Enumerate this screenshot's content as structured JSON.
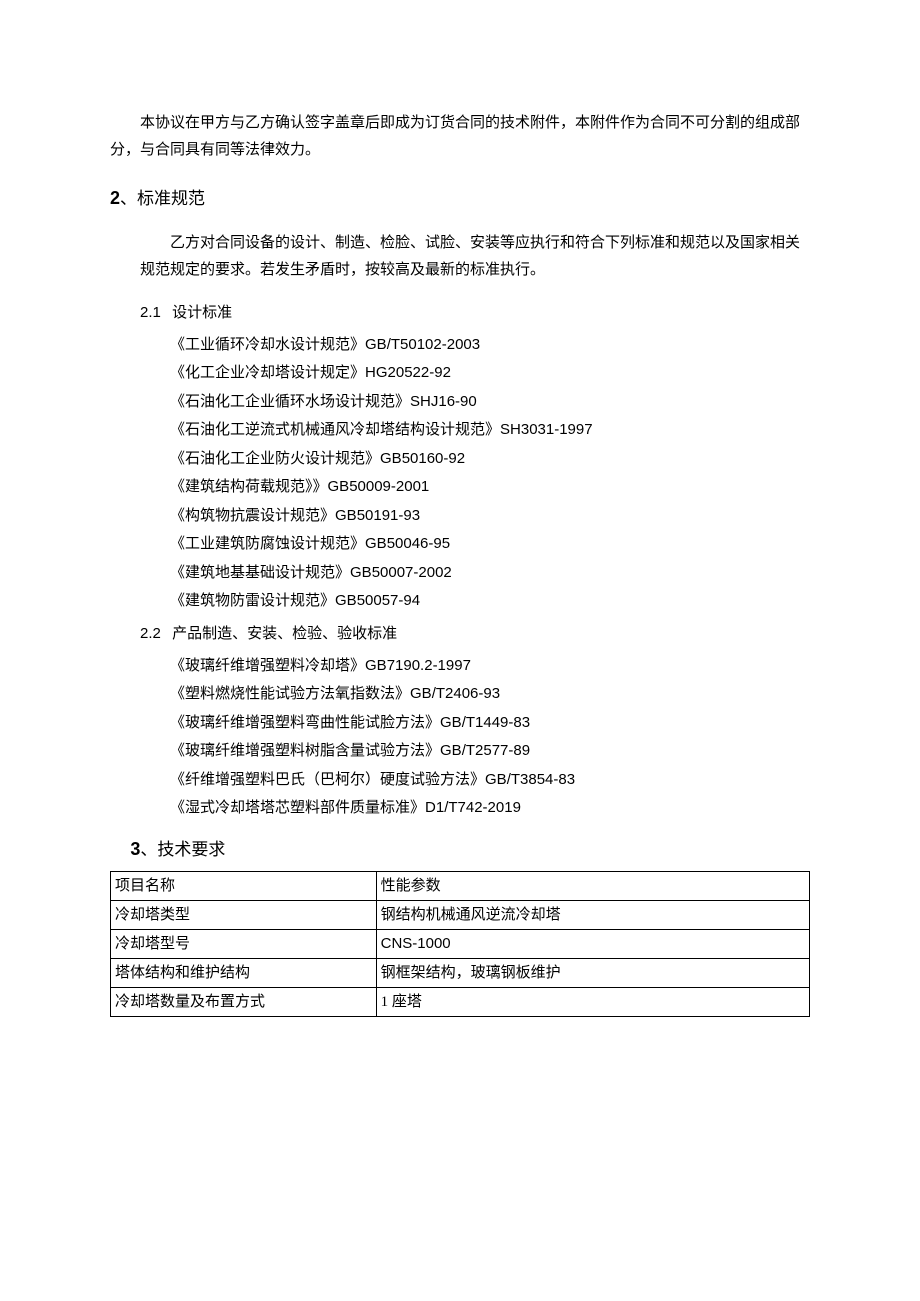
{
  "intro": "本协议在甲方与乙方确认签字盖章后即成为订货合同的技术附件，本附件作为合同不可分割的组成部分，与合同具有同等法律效力。",
  "section2": {
    "num": "2",
    "punct": "、",
    "title": "标准规范",
    "lead": "乙方对合同设备的设计、制造、检脸、试脸、安装等应执行和符合下列标准和规范以及国家相关规范规定的要求。若发生矛盾时，按较高及最新的标准执行。",
    "sub1": {
      "num": "2.1",
      "title": "设计标准"
    },
    "design_standards": [
      {
        "name": "《工业循环冷却水设计规范》",
        "code": "GB/T50102-2003"
      },
      {
        "name": "《化工企业冷却塔设计规定》",
        "code": "HG20522-92"
      },
      {
        "name": "《石油化工企业循环水场设计规范》",
        "code": "SHJ16-90"
      },
      {
        "name": "《石油化工逆流式机械通风冷却塔结构设计规范》",
        "code": "SH3031-1997"
      },
      {
        "name": "《石油化工企业防火设计规范》",
        "code": "GB50160-92"
      },
      {
        "name": "《建筑结构荷载规范》》",
        "code": "GB50009-2001"
      },
      {
        "name": "《构筑物抗震设计规范》",
        "code": "GB50191-93"
      },
      {
        "name": "《工业建筑防腐蚀设计规范》",
        "code": "GB50046-95"
      },
      {
        "name": "《建筑地基基础设计规范》",
        "code": "GB50007-2002"
      },
      {
        "name": "《建筑物防雷设计规范》",
        "code": "GB50057-94"
      }
    ],
    "sub2": {
      "num": "2.2",
      "title": "产品制造、安装、检验、验收标准"
    },
    "product_standards": [
      {
        "name": "《玻璃纤维增强塑料冷却塔》",
        "code": "GB7190.2-1997"
      },
      {
        "name": "《塑料燃烧性能试验方法氧指数法》",
        "code": "GB/T2406-93"
      },
      {
        "name": "《玻璃纤维增强塑料弯曲性能试脸方法》",
        "code": "GB/T1449-83"
      },
      {
        "name": "《玻璃纤维增强塑料树脂含量试验方法》",
        "code": "GB/T2577-89"
      },
      {
        "name": "《纤维增强塑料巴氏（巴柯尔）硬度试验方法》",
        "code": "GB/T3854-83"
      },
      {
        "name": "《湿式冷却塔塔芯塑料部件质量标准》",
        "code": "D1/T742-2019"
      }
    ]
  },
  "section3": {
    "num": "3",
    "punct": "、",
    "title": "技术要求",
    "table": [
      {
        "k": "项目名称",
        "v": "性能参数"
      },
      {
        "k": "冷却塔类型",
        "v": "钢结构机械通风逆流冷却塔"
      },
      {
        "k": "冷却塔型号",
        "v": "CNS-1000",
        "latin": true
      },
      {
        "k": "塔体结构和维护结构",
        "v": "钢框架结构，玻璃钢板维护"
      },
      {
        "k": "冷却塔数量及布置方式",
        "v": "1 座塔"
      }
    ]
  }
}
